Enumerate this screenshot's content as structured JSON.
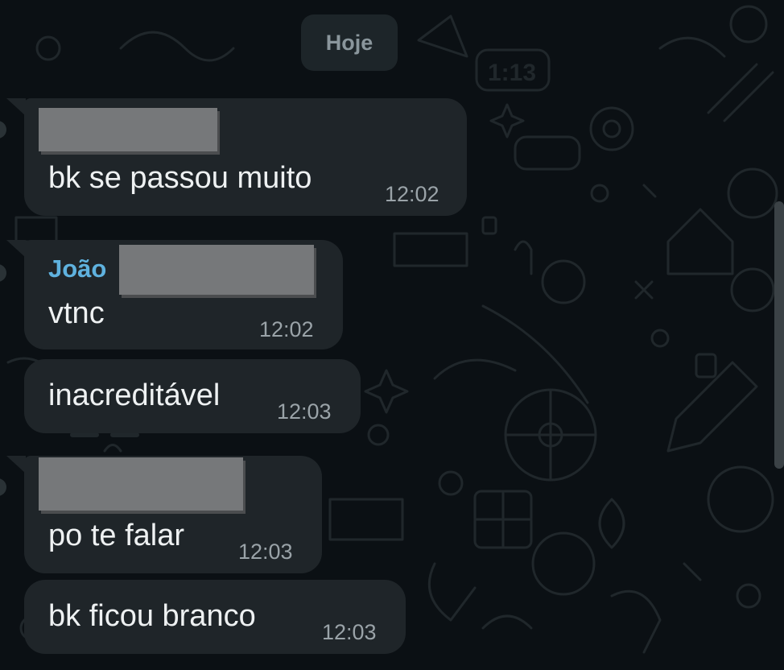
{
  "chat": {
    "date_label": "Hoje",
    "messages": [
      {
        "sender": "",
        "text": "bk se passou muito",
        "time": "12:02"
      },
      {
        "sender": "João",
        "text": "vtnc",
        "time": "12:02"
      },
      {
        "sender": "",
        "text": "inacreditável",
        "time": "12:03"
      },
      {
        "sender": "",
        "text": "po te falar",
        "time": "12:03"
      },
      {
        "sender": "",
        "text": "bk ficou branco",
        "time": "12:03"
      }
    ]
  },
  "colors": {
    "background": "#0b1014",
    "bubble": "#1f2529",
    "sender_name": "#5fb2df",
    "redaction": "#76787a"
  }
}
